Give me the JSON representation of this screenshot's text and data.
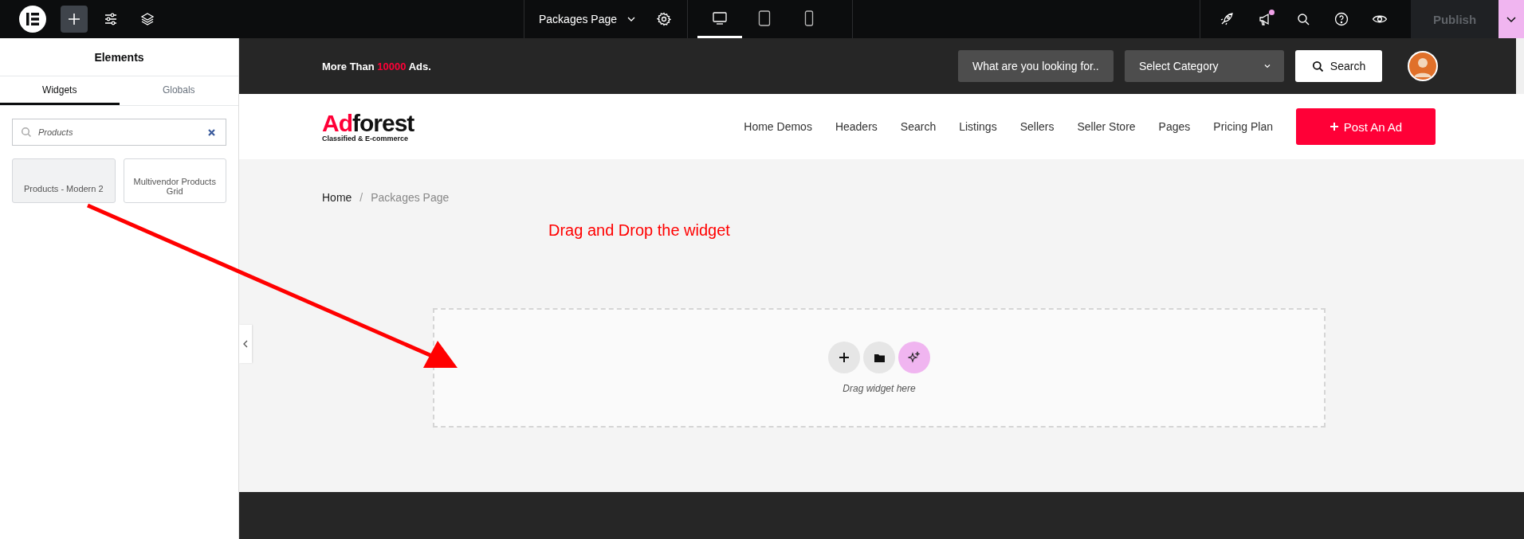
{
  "topbar": {
    "page_title": "Packages Page",
    "devices": [
      {
        "kind": "desktop",
        "selected": true
      },
      {
        "kind": "tablet",
        "selected": false
      },
      {
        "kind": "mobile",
        "selected": false
      }
    ],
    "notification": true,
    "publish": {
      "label": "Publish",
      "disabled": true
    }
  },
  "panel": {
    "title": "Elements",
    "tabs": [
      {
        "label": "Widgets",
        "selected": true
      },
      {
        "label": "Globals",
        "selected": false
      }
    ],
    "search": {
      "value": "Products"
    },
    "widgets": [
      {
        "label": "Products - Modern 2",
        "hovered": true
      },
      {
        "label": "Multivendor Products Grid",
        "hovered": false
      }
    ]
  },
  "site": {
    "topline": {
      "prefix": "More Than ",
      "highlight": "10000",
      "suffix": " Ads."
    },
    "search_placeholder": "What are you looking for..",
    "category": "Select Category",
    "search_button": "Search",
    "logo": {
      "accent": "Ad",
      "rest": "forest",
      "tagline": "Classified & E-commerce"
    },
    "nav": [
      "Home Demos",
      "Headers",
      "Search",
      "Listings",
      "Sellers",
      "Seller Store",
      "Pages",
      "Pricing Plan"
    ],
    "post_button": "Post An Ad",
    "breadcrumb": {
      "items": [
        "Home",
        "Packages Page"
      ],
      "separator": "/"
    },
    "annotation": "Drag and Drop the widget",
    "dropzone": "Drag widget here"
  }
}
